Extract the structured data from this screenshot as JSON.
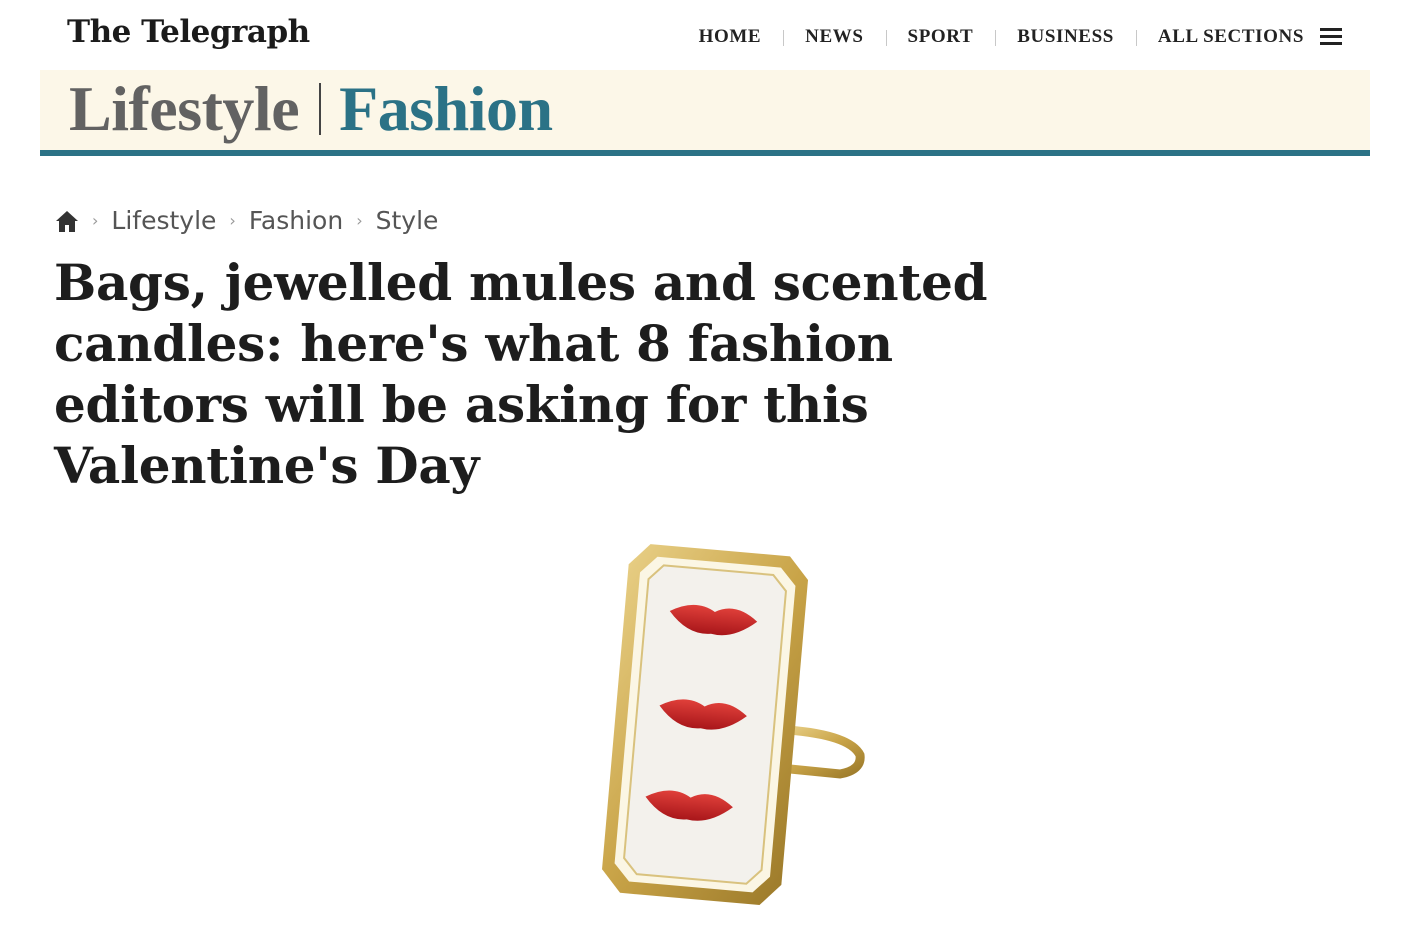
{
  "header": {
    "logo": "The Telegraph",
    "nav": [
      "HOME",
      "NEWS",
      "SPORT",
      "BUSINESS",
      "ALL SECTIONS"
    ]
  },
  "section": {
    "main": "Lifestyle",
    "sub": "Fashion"
  },
  "breadcrumb": [
    "Lifestyle",
    "Fashion",
    "Style"
  ],
  "article": {
    "headline": "Bags, jewelled mules and scented candles: here's what 8 fashion editors will be asking for this Valentine's Day"
  },
  "colors": {
    "accent": "#2b7286",
    "band": "#fcf7e8",
    "lips": "#c8221f",
    "gold": "#c9a448"
  },
  "icons": {
    "home": "home-icon",
    "menu": "hamburger-menu-icon"
  }
}
